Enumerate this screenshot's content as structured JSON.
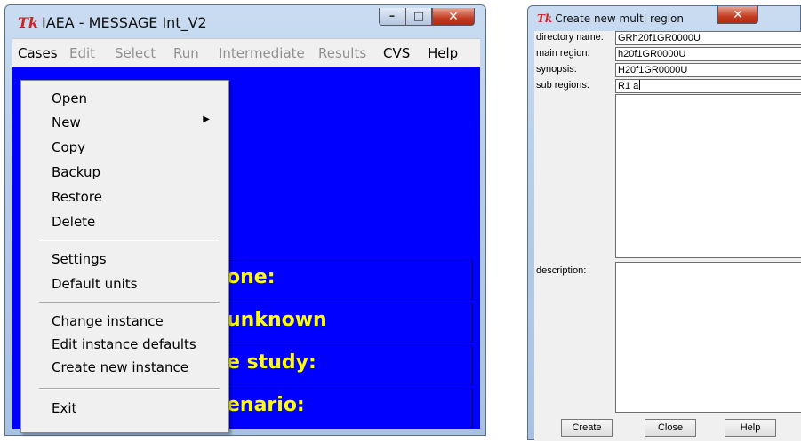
{
  "left_window": {
    "title": "IAEA - MESSAGE Int_V2",
    "logo": "Tk",
    "caption": {
      "minimize": "minimize-icon",
      "maximize": "maximize-icon",
      "close": "close-icon"
    },
    "menubar": [
      {
        "label": "Cases",
        "enabled": true
      },
      {
        "label": "Edit",
        "enabled": false
      },
      {
        "label": "Select",
        "enabled": false
      },
      {
        "label": "Run",
        "enabled": false
      },
      {
        "label": "Intermediate",
        "enabled": false
      },
      {
        "label": "Results",
        "enabled": false
      },
      {
        "label": "CVS",
        "enabled": true
      },
      {
        "label": "Help",
        "enabled": true
      }
    ],
    "cases_menu": {
      "open": "Open",
      "new": "New",
      "copy": "Copy",
      "backup": "Backup",
      "restore": "Restore",
      "delete": "Delete",
      "settings": "Settings",
      "default_units": "Default units",
      "change_instance": "Change instance",
      "edit_instance_defaults": "Edit instance defaults",
      "create_new_instance": "Create new instance",
      "exit": "Exit"
    },
    "background_rows": [
      "one:",
      "unknown",
      "e study:",
      "enario:"
    ],
    "colors": {
      "client_bg": "#0000ff",
      "row_text": "#ffff00"
    }
  },
  "right_window": {
    "title": "Create new multi region",
    "logo": "Tk",
    "fields": {
      "directory_name": {
        "label": "directory name:",
        "value": "GRh20f1GR0000U"
      },
      "main_region": {
        "label": "main region:",
        "value": "h20f1GR0000U"
      },
      "synopsis": {
        "label": "synopsis:",
        "value": "H20f1GR0000U"
      },
      "sub_regions": {
        "label": "sub regions:",
        "value": "R1 a"
      },
      "description": {
        "label": "description:"
      }
    },
    "buttons": {
      "create": "Create",
      "close": "Close",
      "help": "Help"
    }
  }
}
